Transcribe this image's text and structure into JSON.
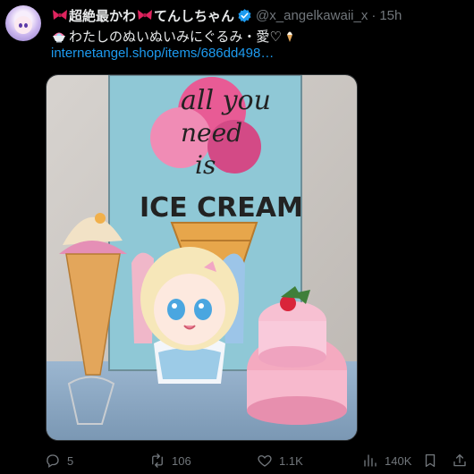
{
  "tweet": {
    "display_name": "超絶最かわてんしちゃん",
    "display_name_part1": "超絶最かわ",
    "display_name_part2": "てんしちゃん",
    "handle": "@x_angelkawaii_x",
    "separator": "·",
    "time": "15h",
    "text": "わたしのぬいぬいみにぐるみ・愛♡",
    "link": "internetangel.shop/items/686dd498…",
    "image_text": "all you need is ICE CREAM"
  },
  "actions": {
    "replies": "5",
    "reposts": "106",
    "likes": "1.1K",
    "views": "140K"
  },
  "icons": {
    "avatar": "profile-avatar",
    "bow": "ribbon-bow-emoji",
    "verified": "verified-badge-icon",
    "ice_cream_emoji": "shaved-ice-emoji",
    "soft_serve_emoji": "soft-ice-cream-emoji",
    "reply": "reply-icon",
    "repost": "repost-icon",
    "like": "heart-icon",
    "views": "views-chart-icon",
    "bookmark": "bookmark-icon",
    "share": "share-icon"
  },
  "colors": {
    "background": "#000000",
    "text_primary": "#e7e9ea",
    "text_secondary": "#71767b",
    "link": "#1d9bf0",
    "verified": "#1d9bf0",
    "bow": "#e0245e"
  }
}
